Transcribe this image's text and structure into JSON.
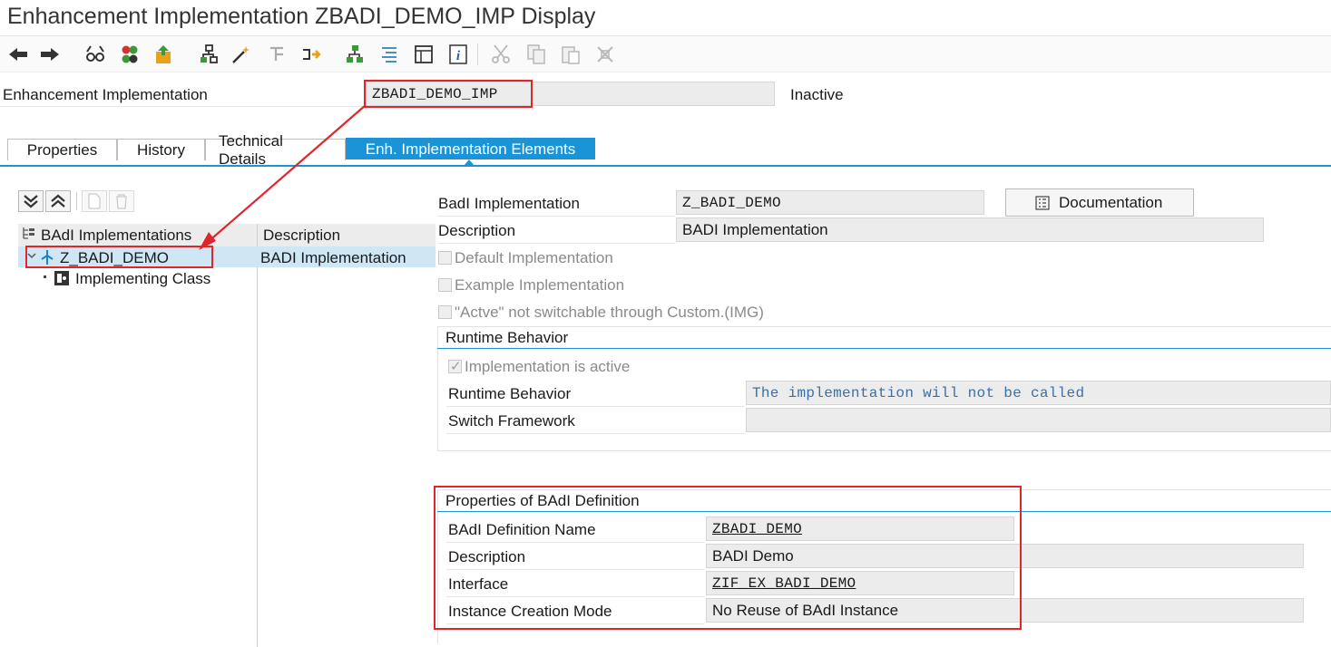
{
  "window": {
    "title": "Enhancement Implementation ZBADI_DEMO_IMP Display"
  },
  "toolbar": {
    "icons": [
      "back-icon",
      "forward-icon",
      "glasses-icon",
      "activate-icon",
      "transport-icon",
      "hierarchy-icon",
      "magic-wand-icon",
      "where-used-icon",
      "navigate-icon",
      "structure-icon",
      "indent-icon",
      "document-icon",
      "info-icon",
      "cut-icon",
      "copy-icon",
      "paste-icon",
      "delete-icon"
    ]
  },
  "header": {
    "label": "Enhancement Implementation",
    "value": "ZBADI_DEMO_IMP",
    "status": "Inactive"
  },
  "tabs": [
    {
      "label": "Properties"
    },
    {
      "label": "History"
    },
    {
      "label": "Technical Details"
    },
    {
      "label": "Enh. Implementation Elements"
    }
  ],
  "tree": {
    "col1_header": "BAdI Implementations",
    "col2_header": "Description",
    "root": {
      "label": "Z_BADI_DEMO",
      "description": "BADI Implementation"
    },
    "child": {
      "label": "Implementing Class"
    }
  },
  "detail": {
    "badi_impl_label": "BadI Implementation",
    "badi_impl_value": "Z_BADI_DEMO",
    "documentation_button": "Documentation",
    "description_label": "Description",
    "description_value": "BADI Implementation",
    "default_impl": "Default Implementation",
    "example_impl": "Example Implementation",
    "not_switchable": "\"Actve\" not switchable through Custom.(IMG)"
  },
  "runtime": {
    "title": "Runtime Behavior",
    "impl_active": "Implementation is active",
    "behavior_label": "Runtime Behavior",
    "behavior_value": "The implementation will not be called",
    "switch_label": "Switch Framework",
    "switch_value": ""
  },
  "badi_def": {
    "title": "Properties of BAdI Definition",
    "name_label": "BAdI Definition Name",
    "name_value": "ZBADI_DEMO",
    "desc_label": "Description",
    "desc_value": "BADI Demo",
    "interface_label": "Interface",
    "interface_value": "ZIF_EX_BADI_DEMO",
    "mode_label": "Instance Creation Mode",
    "mode_value": "No Reuse of BAdI Instance"
  },
  "colors": {
    "accent": "#1a94d6",
    "highlight": "#e0262a",
    "selected_row": "#cfe6f5"
  }
}
